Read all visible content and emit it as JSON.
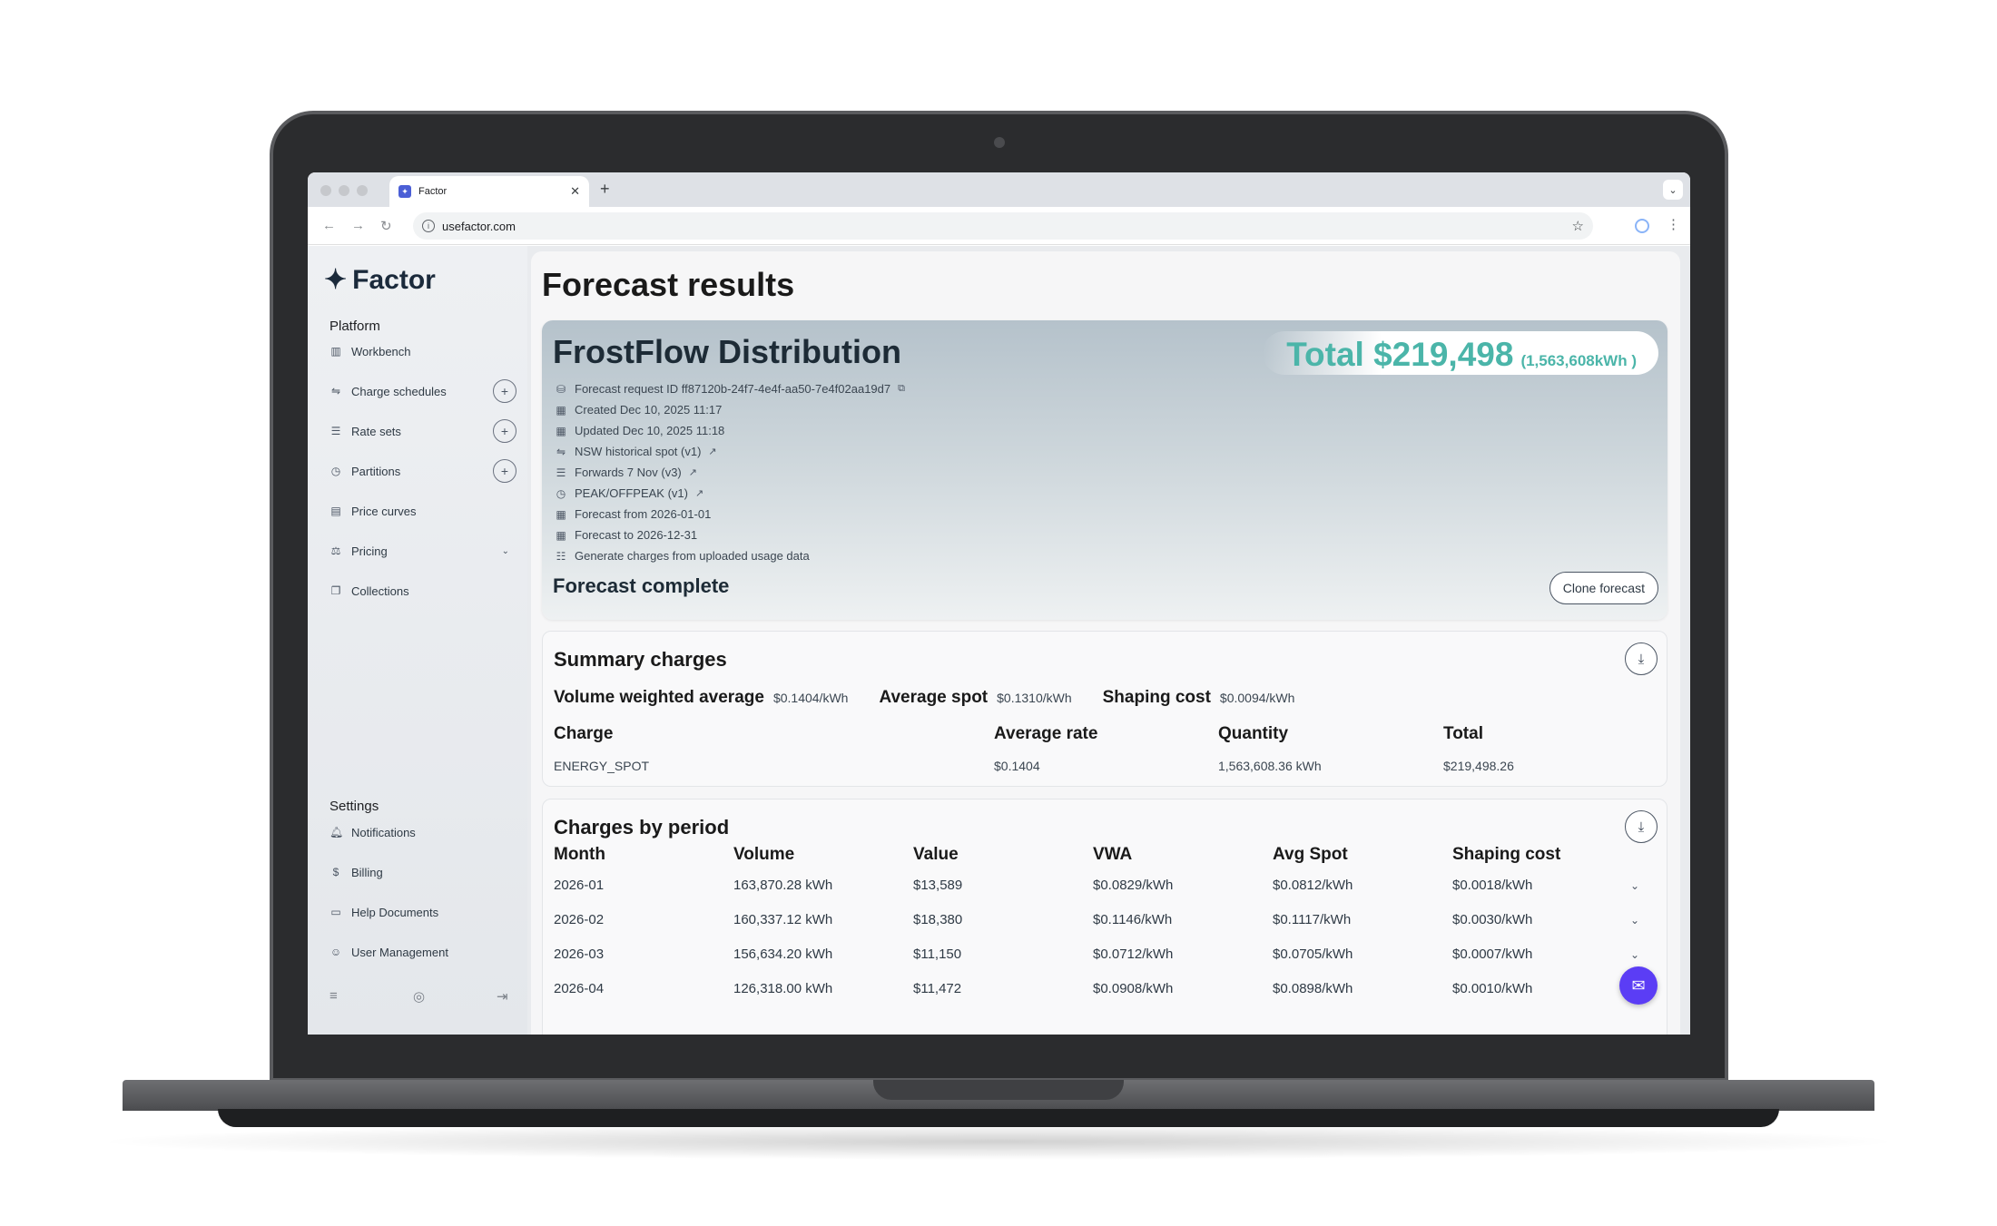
{
  "browser": {
    "tab_title": "Factor",
    "tab_close": "✕",
    "new_tab": "+",
    "tab_menu": "⌄",
    "url": "usefactor.com",
    "icons": [
      "back-icon",
      "forward-icon",
      "reload-icon",
      "star-icon",
      "profile-icon",
      "kebab-icon"
    ]
  },
  "sidebar": {
    "logo_text": "Factor",
    "platform_label": "Platform",
    "platform_items": [
      {
        "label": "Workbench",
        "icon": "bar-chart-icon",
        "action": ""
      },
      {
        "label": "Charge schedules",
        "icon": "schedule-icon",
        "action": "+"
      },
      {
        "label": "Rate sets",
        "icon": "list-icon",
        "action": "+"
      },
      {
        "label": "Partitions",
        "icon": "clock-icon",
        "action": "+"
      },
      {
        "label": "Price curves",
        "icon": "curve-icon",
        "action": ""
      },
      {
        "label": "Pricing",
        "icon": "scale-icon",
        "action": "⌄"
      },
      {
        "label": "Collections",
        "icon": "folder-icon",
        "action": ""
      }
    ],
    "settings_label": "Settings",
    "settings_items": [
      {
        "label": "Notifications",
        "icon": "bell-icon"
      },
      {
        "label": "Billing",
        "icon": "dollar-icon"
      },
      {
        "label": "Help Documents",
        "icon": "doc-icon"
      },
      {
        "label": "User Management",
        "icon": "user-icon"
      }
    ]
  },
  "main": {
    "page_title": "Forecast results",
    "hero": {
      "company": "FrostFlow Distribution",
      "total": "Total $219,498",
      "total_kwh": "(1,563,608kWh )",
      "meta": [
        {
          "icon": "database-icon",
          "text": "Forecast request ID ff87120b-24f7-4e4f-aa50-7e4f02aa19d7",
          "suffix": "⧉"
        },
        {
          "icon": "calendar-icon",
          "text": "Created Dec 10, 2025 11:17",
          "suffix": ""
        },
        {
          "icon": "calendar-icon",
          "text": "Updated Dec 10, 2025 11:18",
          "suffix": ""
        },
        {
          "icon": "schedule-icon",
          "text": "NSW historical spot (v1)",
          "suffix": "↗"
        },
        {
          "icon": "list-icon",
          "text": "Forwards 7 Nov (v3)",
          "suffix": "↗"
        },
        {
          "icon": "clock-icon",
          "text": "PEAK/OFFPEAK (v1)",
          "suffix": "↗"
        },
        {
          "icon": "calendar-icon",
          "text": "Forecast from 2026-01-01",
          "suffix": ""
        },
        {
          "icon": "calendar-icon",
          "text": "Forecast to 2026-12-31",
          "suffix": ""
        },
        {
          "icon": "sliders-icon",
          "text": "Generate charges from uploaded usage data",
          "suffix": ""
        }
      ],
      "status": "Forecast complete",
      "clone_label": "Clone forecast"
    },
    "summary": {
      "title": "Summary charges",
      "stats": [
        {
          "label": "Volume weighted average",
          "value": "$0.1404/kWh"
        },
        {
          "label": "Average spot",
          "value": "$0.1310/kWh"
        },
        {
          "label": "Shaping cost",
          "value": "$0.0094/kWh"
        }
      ],
      "columns": [
        "Charge",
        "Average rate",
        "Quantity",
        "Total"
      ],
      "rows": [
        [
          "ENERGY_SPOT",
          "$0.1404",
          "1,563,608.36 kWh",
          "$219,498.26"
        ]
      ]
    },
    "periods": {
      "title": "Charges by period",
      "columns": [
        "Month",
        "Volume",
        "Value",
        "VWA",
        "Avg Spot",
        "Shaping cost"
      ],
      "rows": [
        [
          "2026-01",
          "163,870.28 kWh",
          "$13,589",
          "$0.0829/kWh",
          "$0.0812/kWh",
          "$0.0018/kWh"
        ],
        [
          "2026-02",
          "160,337.12 kWh",
          "$18,380",
          "$0.1146/kWh",
          "$0.1117/kWh",
          "$0.0030/kWh"
        ],
        [
          "2026-03",
          "156,634.20 kWh",
          "$11,150",
          "$0.0712/kWh",
          "$0.0705/kWh",
          "$0.0007/kWh"
        ],
        [
          "2026-04",
          "126,318.00 kWh",
          "$11,472",
          "$0.0908/kWh",
          "$0.0898/kWh",
          "$0.0010/kWh"
        ]
      ]
    }
  },
  "colors": {
    "accent_teal": "#4bb5a9",
    "chat_purple": "#5b3df5",
    "text_dark": "#1a1a1a"
  }
}
